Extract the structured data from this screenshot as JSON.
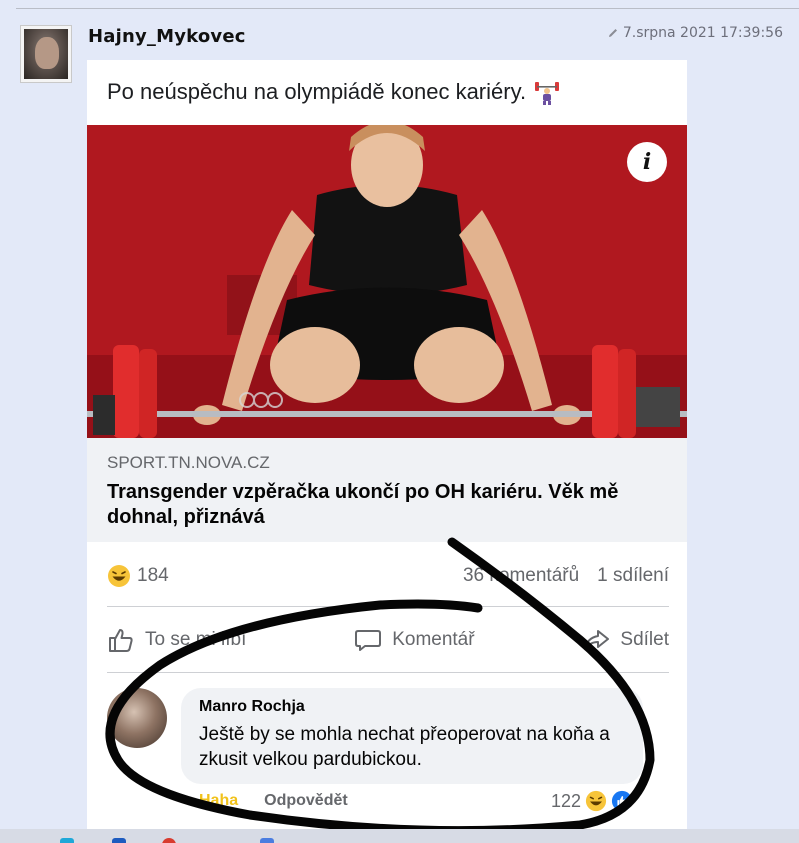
{
  "post": {
    "username": "Hajny_Mykovec",
    "date": "7.srpna 2021 17:39:56"
  },
  "fb": {
    "status_text": "Po neúspěchu na olympiádě konec kariéry.",
    "link": {
      "domain": "SPORT.TN.NOVA.CZ",
      "title": "Transgender vzpěračka ukončí po OH kariéru. Věk mě dohnal, přiznává"
    },
    "reactions_count": "184",
    "comments_count": "36 komentářů",
    "shares_count": "1 sdílení",
    "actions": {
      "like": "To se mi líbí",
      "comment": "Komentář",
      "share": "Sdílet"
    },
    "comment": {
      "author": "Manro Rochja",
      "text": "Ještě by se mohla nechat přeoperovat na koňa a zkusit velkou pardubickou.",
      "haha": "Haha",
      "reply": "Odpovědět",
      "reactions": "122"
    }
  },
  "colors": {
    "background": "#e3e9f8",
    "image_red": "#b41a21",
    "fb_gray": "#65676b",
    "haha_yellow": "#f1c21b"
  },
  "icons": [
    "pencil-icon",
    "lifter-emoji-icon",
    "info-icon",
    "haha-emoji-icon",
    "like-icon",
    "comment-icon",
    "share-icon",
    "like-reaction-icon"
  ]
}
